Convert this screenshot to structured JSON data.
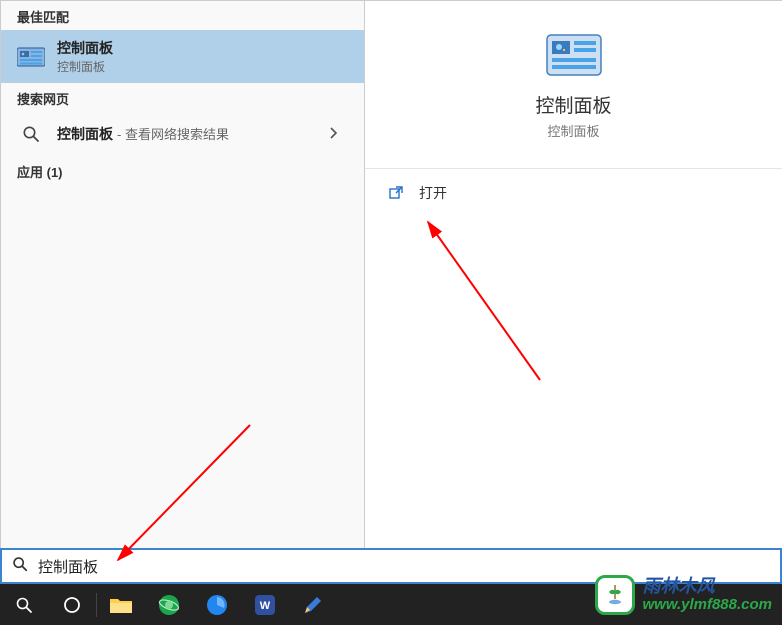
{
  "left": {
    "section_best_match": "最佳匹配",
    "section_web": "搜索网页",
    "section_apps": "应用 (1)",
    "selected": {
      "title": "控制面板",
      "subtitle": "控制面板"
    },
    "web_item": {
      "title": "控制面板",
      "suffix": " - 查看网络搜索结果"
    }
  },
  "right": {
    "preview_title": "控制面板",
    "preview_subtitle": "控制面板",
    "action_open": "打开"
  },
  "searchbar": {
    "value": "控制面板"
  },
  "watermark": {
    "line1": "雨林木风",
    "line2": "www.ylmf888.com"
  },
  "icons": {
    "control_panel": "control-panel-icon",
    "search": "search-icon",
    "chevron_right": "chevron-right-icon",
    "open_external": "open-external-icon",
    "start": "start-icon",
    "cortana": "cortana-icon",
    "file_explorer": "file-explorer-icon",
    "browser_green": "browser-green-icon",
    "browser_blue": "browser-blue-icon",
    "wps": "wps-icon",
    "pencil": "pencil-icon"
  },
  "colors": {
    "selection": "#b0d0ea",
    "search_border": "#3b84d1",
    "taskbar": "#222222"
  }
}
